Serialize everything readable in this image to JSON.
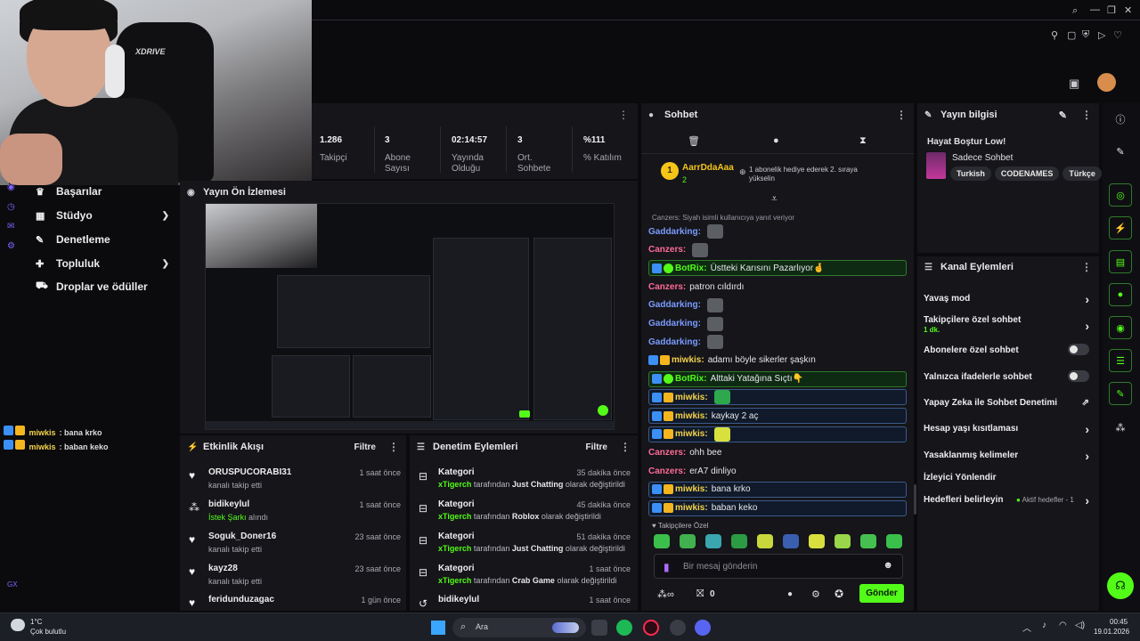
{
  "colors": {
    "accent": "#53fc18",
    "bg": "#0b0b0e",
    "panel": "#15151a"
  },
  "left_overlay_chat": [
    {
      "user": "miwkis",
      "text": ": bana krko"
    },
    {
      "user": "miwkis",
      "text": ": baban keko"
    }
  ],
  "nav": {
    "items": [
      {
        "icon": "trophy-icon",
        "label": "Başarılar",
        "has_chevron": false
      },
      {
        "icon": "studio-icon",
        "label": "Stüdyo",
        "has_chevron": true
      },
      {
        "icon": "wrench-icon",
        "label": "Denetleme",
        "has_chevron": false
      },
      {
        "icon": "community-icon",
        "label": "Topluluk",
        "has_chevron": true
      },
      {
        "icon": "drops-icon",
        "label": "Droplar ve ödüller",
        "has_chevron": false
      }
    ],
    "footer_tag": "GX"
  },
  "stats": [
    {
      "value": "1.286",
      "label": "Takipçi"
    },
    {
      "value": "3",
      "label": "Abone Sayısı"
    },
    {
      "value": "02:14:57",
      "label": "Yayında Olduğu"
    },
    {
      "value": "3",
      "label": "Ort. Sohbete"
    },
    {
      "value": "%111",
      "label": "% Katılım"
    }
  ],
  "preview": {
    "title": "Yayın Ön İzlemesi"
  },
  "activity": {
    "title": "Etkinlik Akışı",
    "filter": "Filtre",
    "rows": [
      {
        "icon": "heart-icon",
        "name": "ORUSPUCORABI31",
        "desc": "kanalı takip etti",
        "highlight": "",
        "time": "1 saat önce"
      },
      {
        "icon": "song-icon",
        "name": "bidikeylul",
        "desc": " alındı",
        "highlight": "İstek Şarkı",
        "time": "1 saat önce"
      },
      {
        "icon": "heart-icon",
        "name": "Soguk_Doner16",
        "desc": "kanalı takip etti",
        "highlight": "",
        "time": "23 saat önce"
      },
      {
        "icon": "heart-icon",
        "name": "kayz28",
        "desc": "kanalı takip etti",
        "highlight": "",
        "time": "23 saat önce"
      },
      {
        "icon": "heart-icon",
        "name": "feridunduzagac",
        "desc": "",
        "highlight": "",
        "time": "1 gün önce"
      }
    ]
  },
  "moderation": {
    "title": "Denetim Eylemleri",
    "filter": "Filtre",
    "rows": [
      {
        "title": "Kategori",
        "by": "xTigerch",
        "mid": " tarafından ",
        "cat": "Just Chatting",
        "end": " olarak değiştirildi",
        "time": "35 dakika önce"
      },
      {
        "title": "Kategori",
        "by": "xTigerch",
        "mid": " tarafından ",
        "cat": "Roblox",
        "end": " olarak değiştirildi",
        "time": "45 dakika önce"
      },
      {
        "title": "Kategori",
        "by": "xTigerch",
        "mid": " tarafından ",
        "cat": "Just Chatting",
        "end": " olarak değiştirildi",
        "time": "51 dakika önce"
      },
      {
        "title": "Kategori",
        "by": "xTigerch",
        "mid": " tarafından ",
        "cat": "Crab Game",
        "end": " olarak değiştirildi",
        "time": "1 saat önce"
      },
      {
        "title": "bidikeylul",
        "by": "",
        "mid": "",
        "cat": "",
        "end": "",
        "time": "1 saat önce"
      }
    ]
  },
  "chat": {
    "title": "Sohbet",
    "pinned_user": "AarrDdaAaa",
    "pinned_count": "2",
    "pinned_text": "1 abonelik hediye ederek 2. sıraya yükselin",
    "reply_note": "Canzers: Siyah isimli kullanıcıya yanıt veriyor",
    "messages": [
      {
        "user": "Gaddarking:",
        "color": "blue",
        "text": "",
        "emote": "gray",
        "style": "",
        "badges": ""
      },
      {
        "user": "Canzers:",
        "color": "pink",
        "text": "",
        "emote": "gray",
        "style": "",
        "badges": ""
      },
      {
        "user": "BotRix:",
        "color": "green",
        "text": "Üstteki Karısını Pazarlıyor🤞",
        "emote": "",
        "style": "hl",
        "badges": "bot"
      },
      {
        "user": "Canzers:",
        "color": "pink",
        "text": "patron cıldırdı",
        "emote": "",
        "style": "",
        "badges": ""
      },
      {
        "user": "Gaddarking:",
        "color": "blue",
        "text": "",
        "emote": "gray",
        "style": "",
        "badges": ""
      },
      {
        "user": "Gaddarking:",
        "color": "blue",
        "text": "",
        "emote": "gray",
        "style": "",
        "badges": ""
      },
      {
        "user": "Gaddarking:",
        "color": "blue",
        "text": "",
        "emote": "gray",
        "style": "",
        "badges": ""
      },
      {
        "user": "miwkis:",
        "color": "yellow",
        "text": "adamı böyle sikerler şaşkın",
        "emote": "",
        "style": "",
        "badges": "sub"
      },
      {
        "user": "BotRix:",
        "color": "green",
        "text": "Alttaki Yatağına Sıçtı👇",
        "emote": "",
        "style": "hl",
        "badges": "bot"
      },
      {
        "user": "miwkis:",
        "color": "yellow",
        "text": "",
        "emote": "green",
        "style": "hl2",
        "badges": "sub"
      },
      {
        "user": "miwkis:",
        "color": "yellow",
        "text": "kaykay 2 aç",
        "emote": "",
        "style": "hl2",
        "badges": "sub"
      },
      {
        "user": "miwkis:",
        "color": "yellow",
        "text": "",
        "emote": "yellow",
        "style": "hl2",
        "badges": "sub"
      },
      {
        "user": "Canzers:",
        "color": "pink",
        "text": "ohh bee",
        "emote": "",
        "style": "",
        "badges": ""
      },
      {
        "user": "Canzers:",
        "color": "pink",
        "text": "erA7 dinliyo",
        "emote": "",
        "style": "",
        "badges": ""
      },
      {
        "user": "miwkis:",
        "color": "yellow",
        "text": "bana krko",
        "emote": "",
        "style": "hl2",
        "badges": "sub"
      },
      {
        "user": "miwkis:",
        "color": "yellow",
        "text": "baban keko",
        "emote": "",
        "style": "hl2",
        "badges": "sub"
      }
    ],
    "followers_only_label": "Takipçilere Özel",
    "input_placeholder": "Bir mesaj gönderin",
    "points": "0",
    "send": "Gönder"
  },
  "info": {
    "title": "Yayın bilgisi",
    "stream_title": "Hayat Boştur Low!",
    "category": "Sadece Sohbet",
    "tags": [
      "Turkish",
      "CODENAMES",
      "Türkçe"
    ]
  },
  "kanal": {
    "title": "Kanal Eylemleri",
    "rows": [
      {
        "label": "Yavaş mod",
        "control": "arrow",
        "sub": ""
      },
      {
        "label": "Takipçilere özel sohbet",
        "control": "arrow",
        "sub": "1 dk."
      },
      {
        "label": "Abonelere özel sohbet",
        "control": "toggle",
        "sub": ""
      },
      {
        "label": "Yalnızca ifadelerle sohbet",
        "control": "toggle",
        "sub": ""
      },
      {
        "label": "Yapay Zeka ile Sohbet Denetimi",
        "control": "external",
        "sub": ""
      },
      {
        "label": "Hesap yaşı kısıtlaması",
        "control": "arrow",
        "sub": ""
      },
      {
        "label": "Yasaklanmış kelimeler",
        "control": "arrow",
        "sub": ""
      },
      {
        "label": "İzleyici Yönlendir",
        "control": "none",
        "sub": ""
      },
      {
        "label": "Hedefleri belirleyin",
        "control": "arrow",
        "sub": "Aktif hedefler - 1"
      }
    ]
  },
  "taskbar": {
    "weather_temp": "1°C",
    "weather_desc": "Çok bulutlu",
    "search": "Ara",
    "time": "00:45",
    "date": "19.01.2026"
  }
}
